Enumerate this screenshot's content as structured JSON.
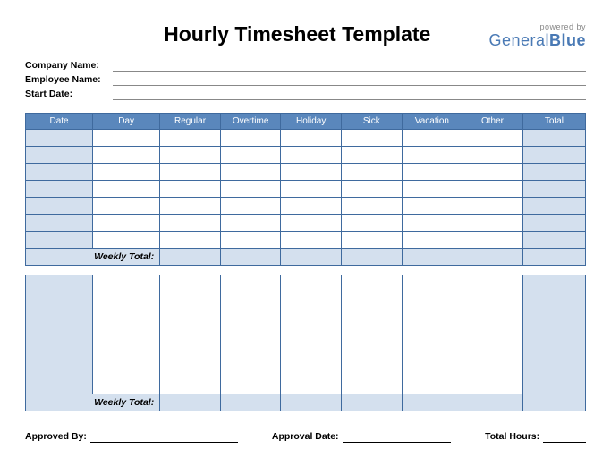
{
  "title": "Hourly Timesheet Template",
  "logo": {
    "powered": "powered by",
    "brand_a": "General",
    "brand_b": "Blue"
  },
  "meta": {
    "company_label": "Company Name:",
    "employee_label": "Employee Name:",
    "start_label": "Start Date:"
  },
  "columns": [
    "Date",
    "Day",
    "Regular",
    "Overtime",
    "Holiday",
    "Sick",
    "Vacation",
    "Other",
    "Total"
  ],
  "weekly_total_label": "Weekly Total:",
  "footer": {
    "approved_by": "Approved By:",
    "approval_date": "Approval Date:",
    "total_hours": "Total Hours:"
  },
  "chart_data": {
    "type": "table",
    "columns": [
      "Date",
      "Day",
      "Regular",
      "Overtime",
      "Holiday",
      "Sick",
      "Vacation",
      "Other",
      "Total"
    ],
    "weeks": [
      {
        "rows": [
          [
            "",
            "",
            "",
            "",
            "",
            "",
            "",
            "",
            ""
          ],
          [
            "",
            "",
            "",
            "",
            "",
            "",
            "",
            "",
            ""
          ],
          [
            "",
            "",
            "",
            "",
            "",
            "",
            "",
            "",
            ""
          ],
          [
            "",
            "",
            "",
            "",
            "",
            "",
            "",
            "",
            ""
          ],
          [
            "",
            "",
            "",
            "",
            "",
            "",
            "",
            "",
            ""
          ],
          [
            "",
            "",
            "",
            "",
            "",
            "",
            "",
            "",
            ""
          ],
          [
            "",
            "",
            "",
            "",
            "",
            "",
            "",
            "",
            ""
          ]
        ],
        "weekly_total": [
          "",
          "",
          "",
          "",
          "",
          "",
          "",
          ""
        ]
      },
      {
        "rows": [
          [
            "",
            "",
            "",
            "",
            "",
            "",
            "",
            "",
            ""
          ],
          [
            "",
            "",
            "",
            "",
            "",
            "",
            "",
            "",
            ""
          ],
          [
            "",
            "",
            "",
            "",
            "",
            "",
            "",
            "",
            ""
          ],
          [
            "",
            "",
            "",
            "",
            "",
            "",
            "",
            "",
            ""
          ],
          [
            "",
            "",
            "",
            "",
            "",
            "",
            "",
            "",
            ""
          ],
          [
            "",
            "",
            "",
            "",
            "",
            "",
            "",
            "",
            ""
          ],
          [
            "",
            "",
            "",
            "",
            "",
            "",
            "",
            "",
            ""
          ]
        ],
        "weekly_total": [
          "",
          "",
          "",
          "",
          "",
          "",
          "",
          ""
        ]
      }
    ]
  }
}
